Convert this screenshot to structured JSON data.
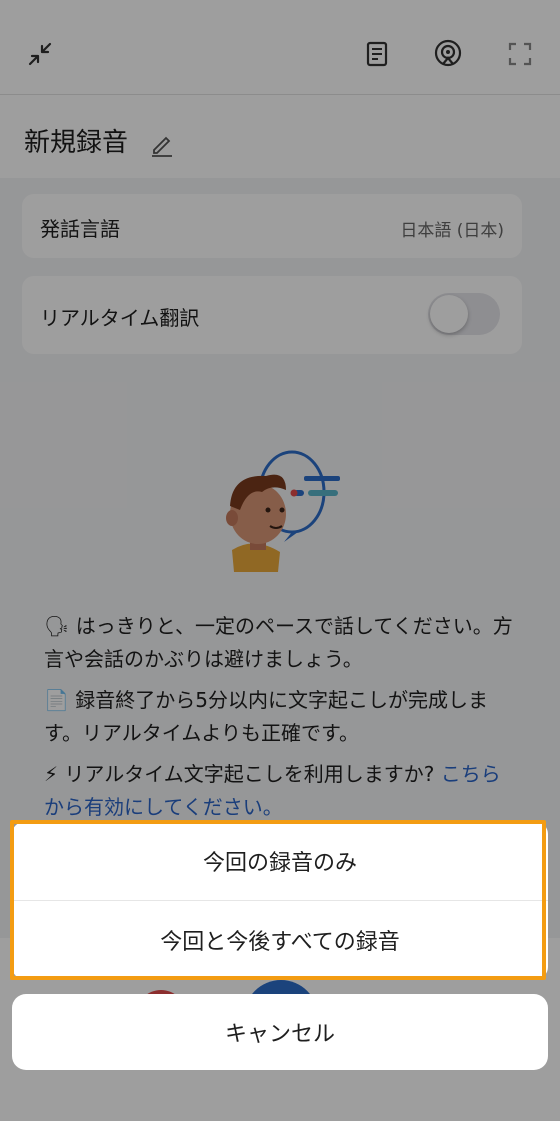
{
  "header": {
    "icons": [
      "collapse-icon",
      "transcript-icon",
      "broadcast-icon",
      "expand-icon"
    ]
  },
  "title": "新規録音",
  "settings": {
    "language_label": "発話言語",
    "language_value": "日本語 (日本)",
    "realtime_translation_label": "リアルタイム翻訳",
    "realtime_translation_on": false
  },
  "tips": [
    {
      "icon": "🗣",
      "text": "はっきりと、一定のペースで話してください。方言や会話のかぶりは避けましょう。"
    },
    {
      "icon": "📄",
      "text": "録音終了から5分以内に文字起こしが完成します。リアルタイムよりも正確です。"
    },
    {
      "icon": "⚡",
      "text": "リアルタイム文字起こしを利用しますか? ",
      "link": "こちらから有効にしてください。"
    }
  ],
  "action_sheet": {
    "options": [
      "今回の録音のみ",
      "今回と今後すべての録音"
    ],
    "cancel": "キャンセル"
  },
  "colors": {
    "accent_link": "#2b64c7",
    "highlight": "#f39c12",
    "overlay": "rgba(0,0,0,0.38)"
  }
}
